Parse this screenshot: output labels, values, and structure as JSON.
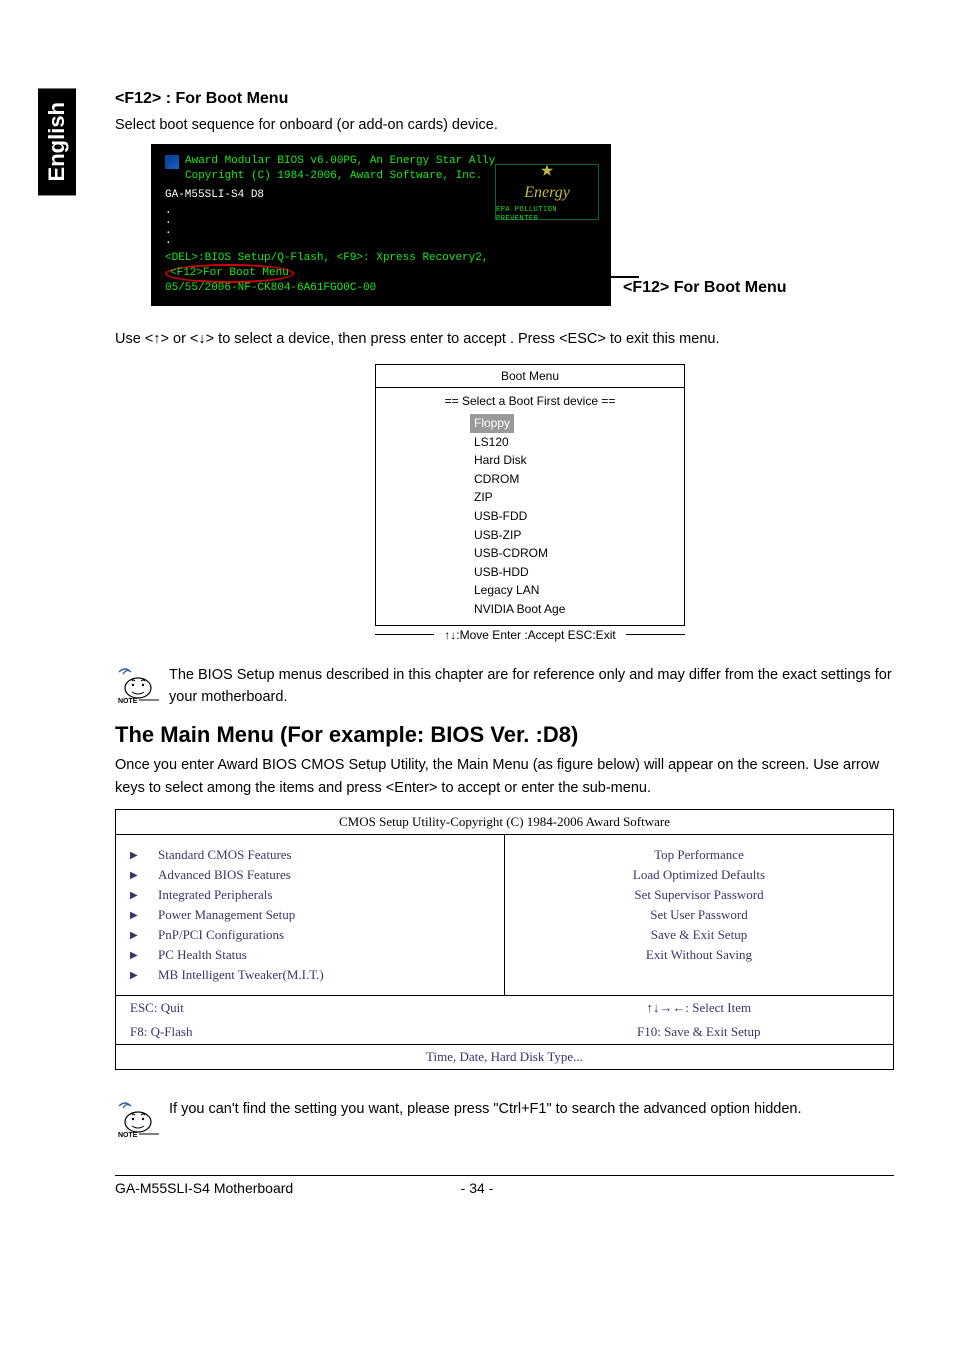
{
  "lang_tab": "English",
  "section1": {
    "title": "<F12> : For Boot Menu",
    "desc": "Select boot sequence for onboard (or add-on cards) device."
  },
  "bios": {
    "line1": "Award Modular BIOS v6.00PG, An Energy Star Ally",
    "line2": "Copyright (C) 1984-2006, Award Software,  Inc.",
    "model": "GA-M55SLI-S4 D8",
    "energy_cursive": "Energy",
    "energy_epa": "EPA  POLLUTION  PREVENTER",
    "hint_pre": "<DEL>:BIOS Setup/Q-Flash, <F9>: Xpress Recovery2,",
    "hint_ellipse": "<F12>For Boot Menu",
    "hint_id": "05/55/2006-NF-CK804-6A61FGO0C-00"
  },
  "callout": "<F12> For Boot Menu",
  "instr_after_bios": "Use <↑> or <↓> to select a device, then press enter to accept . Press <ESC> to exit this menu.",
  "boot_menu": {
    "title": "Boot Menu",
    "subtitle": "==  Select a Boot First device  ==",
    "items": [
      "Floppy",
      "LS120",
      "Hard Disk",
      "CDROM",
      "ZIP",
      "USB-FDD",
      "USB-ZIP",
      "USB-CDROM",
      "USB-HDD",
      "Legacy LAN",
      "NVIDIA Boot Age"
    ],
    "footer": "↑↓:Move   Enter :Accept   ESC:Exit"
  },
  "note1": "The BIOS Setup menus described in this chapter are for reference only and may differ from the exact settings for your motherboard.",
  "main_menu": {
    "title": "The Main Menu (For example: BIOS Ver. :D8)",
    "desc": "Once you enter Award BIOS CMOS Setup Utility, the Main Menu (as figure below) will appear on the screen. Use arrow keys to select among the items and press <Enter> to accept or enter the sub-menu."
  },
  "cmos": {
    "title": "CMOS Setup Utility-Copyright (C) 1984-2006 Award Software",
    "left": [
      "Standard CMOS Features",
      "Advanced BIOS Features",
      "Integrated Peripherals",
      "Power Management Setup",
      "PnP/PCI Configurations",
      "PC Health Status",
      "MB Intelligent Tweaker(M.I.T.)"
    ],
    "right": [
      "Top Performance",
      "Load Optimized Defaults",
      "Set Supervisor Password",
      "Set User Password",
      "Save & Exit Setup",
      "Exit Without Saving"
    ],
    "foot": {
      "r1l": "ESC: Quit",
      "r1r": "↑↓→←: Select Item",
      "r2l": "F8: Q-Flash",
      "r2r": "F10: Save & Exit Setup"
    },
    "descr": "Time, Date, Hard Disk Type..."
  },
  "note2": "If you can't find the setting you want, please press \"Ctrl+F1\" to search the advanced option hidden.",
  "footer": {
    "left": "GA-M55SLI-S4 Motherboard",
    "center": "- 34 -"
  }
}
